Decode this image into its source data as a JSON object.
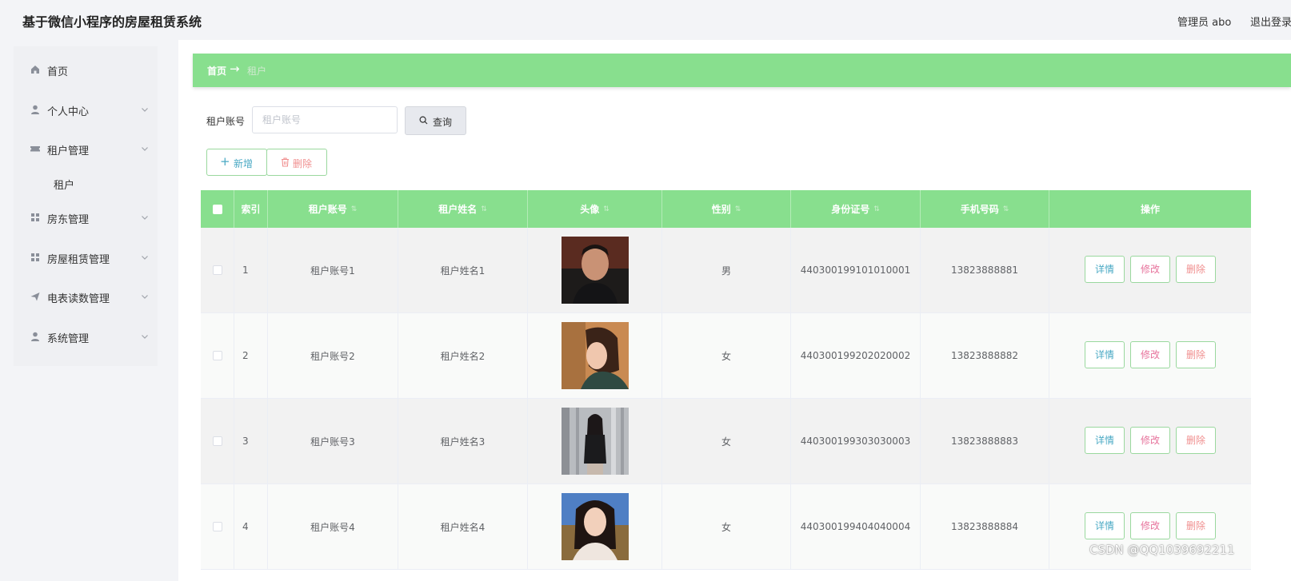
{
  "app": {
    "title": "基于微信小程序的房屋租赁系统"
  },
  "header": {
    "admin_label": "管理员 abo",
    "logout_label": "退出登录"
  },
  "sidebar": {
    "items": [
      {
        "label": "首页",
        "icon": "home-icon"
      },
      {
        "label": "个人中心",
        "icon": "user-icon",
        "has_submenu": true
      },
      {
        "label": "租户管理",
        "icon": "ticket-icon",
        "has_submenu": true,
        "expanded": true
      },
      {
        "label": "房东管理",
        "icon": "grid-icon",
        "has_submenu": true
      },
      {
        "label": "房屋租赁管理",
        "icon": "grid-icon",
        "has_submenu": true
      },
      {
        "label": "电表读数管理",
        "icon": "send-icon",
        "has_submenu": true
      },
      {
        "label": "系统管理",
        "icon": "user-icon",
        "has_submenu": true
      }
    ],
    "subitems": [
      {
        "label": "租户"
      }
    ]
  },
  "breadcrumb": {
    "home": "首页",
    "arrow": "→",
    "current": "租户"
  },
  "search": {
    "label": "租户账号",
    "placeholder": "租户账号",
    "value": "",
    "button_label": "查询"
  },
  "actions": {
    "add_label": "新增",
    "delete_label": "删除"
  },
  "table": {
    "columns": [
      "索引",
      "租户账号",
      "租户姓名",
      "头像",
      "性别",
      "身份证号",
      "手机号码",
      "操作"
    ],
    "rows": [
      {
        "index": "1",
        "account": "租户账号1",
        "name": "租户姓名1",
        "gender": "男",
        "id_number": "440300199101010001",
        "phone": "13823888881"
      },
      {
        "index": "2",
        "account": "租户账号2",
        "name": "租户姓名2",
        "gender": "女",
        "id_number": "440300199202020002",
        "phone": "13823888882"
      },
      {
        "index": "3",
        "account": "租户账号3",
        "name": "租户姓名3",
        "gender": "女",
        "id_number": "440300199303030003",
        "phone": "13823888883"
      },
      {
        "index": "4",
        "account": "租户账号4",
        "name": "租户姓名4",
        "gender": "女",
        "id_number": "440300199404040004",
        "phone": "13823888884"
      }
    ],
    "row_actions": {
      "detail": "详情",
      "edit": "修改",
      "delete": "删除"
    }
  },
  "watermark": "CSDN @QQ1039692211",
  "colors": {
    "accent_green": "#88df8e",
    "border_green": "#9ad89e",
    "detail_blue": "#4aa9c4",
    "edit_pink": "#e7739c",
    "delete_red": "#f08f8f"
  }
}
